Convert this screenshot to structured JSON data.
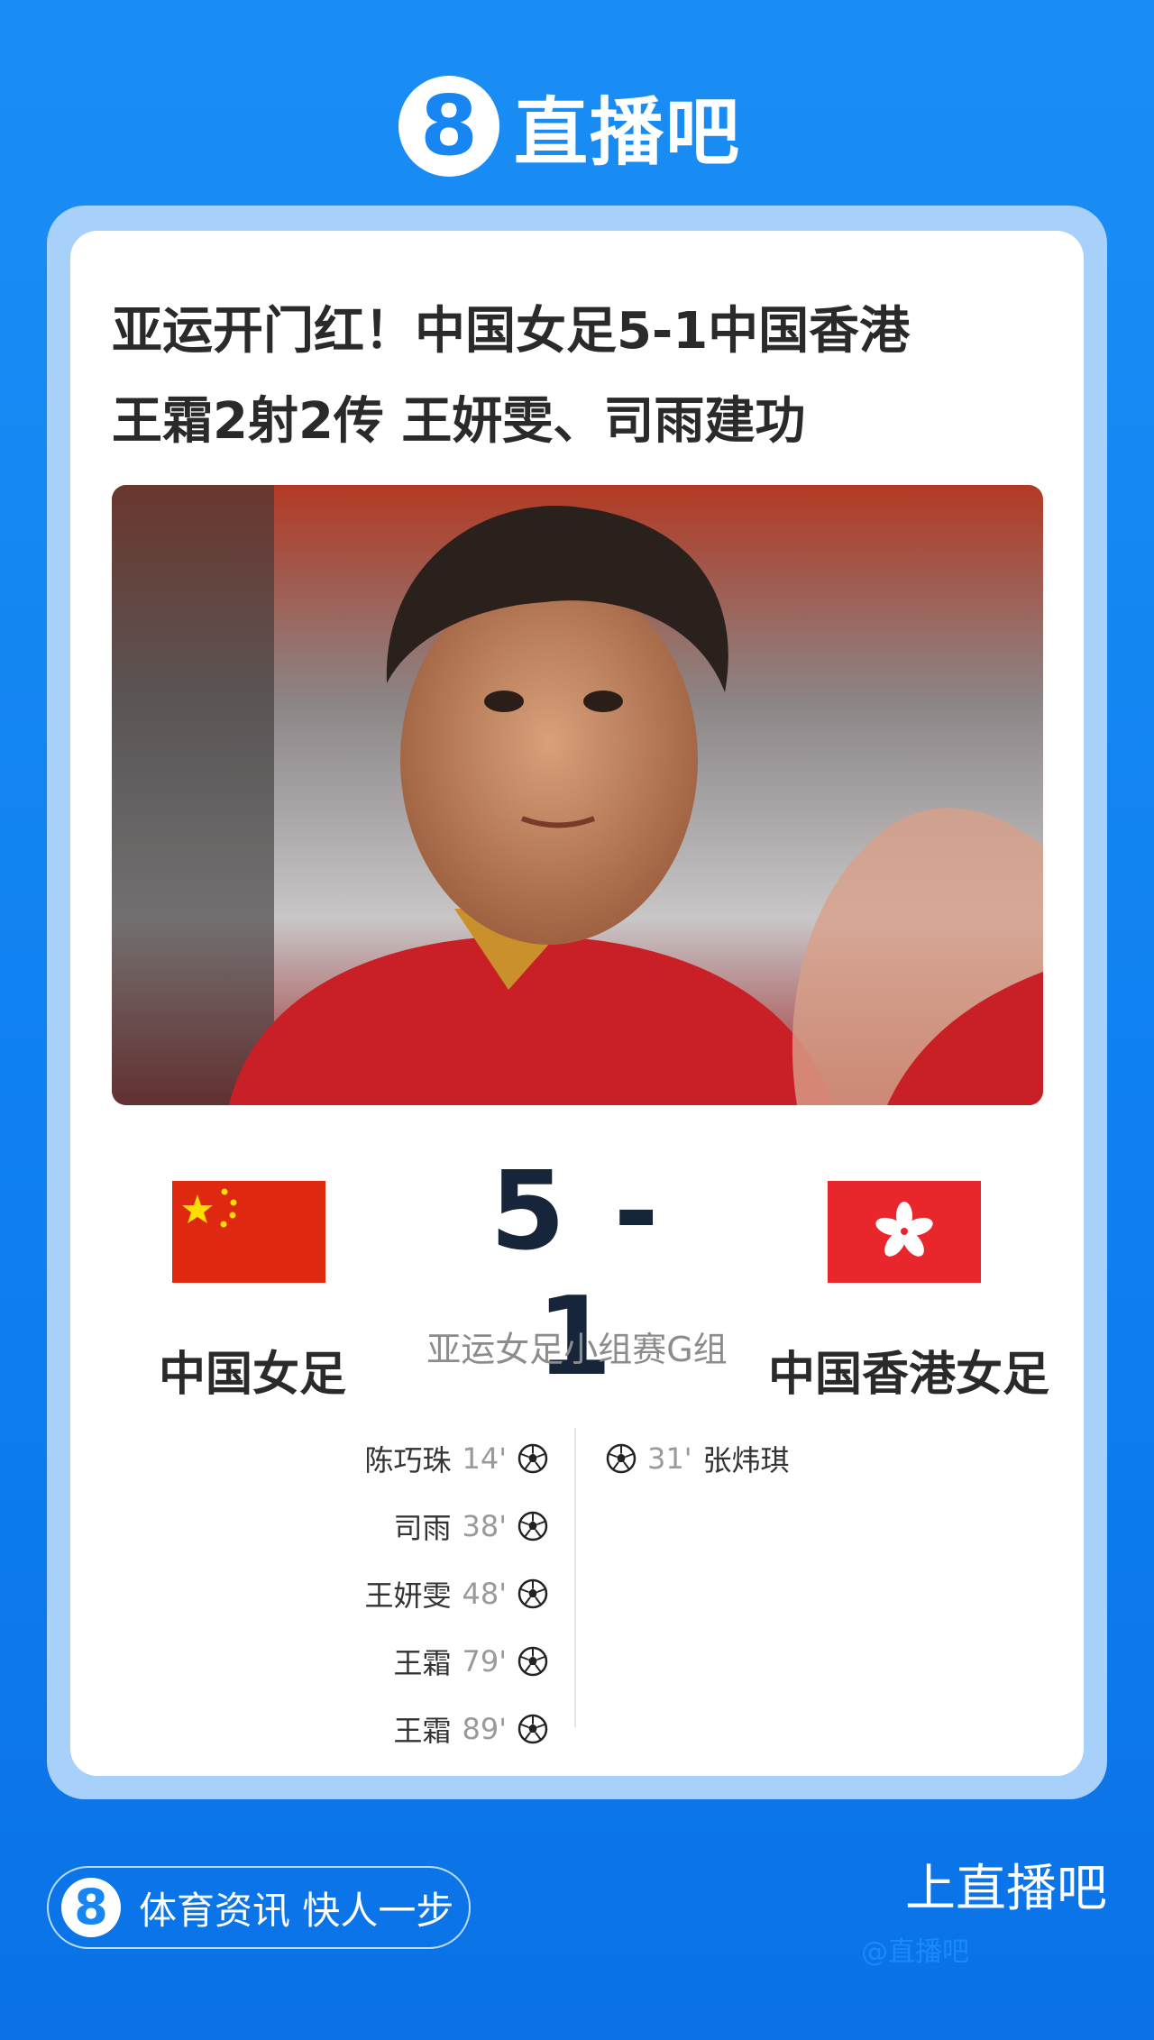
{
  "brand": {
    "logo_digit": "8",
    "name": "直播吧"
  },
  "headline": {
    "line1": "亚运开门红！中国女足5-1中国香港",
    "line2": "王霜2射2传 王妍雯、司雨建功"
  },
  "match": {
    "score": "5 - 1",
    "home_team": "中国女足",
    "away_team": "中国香港女足",
    "competition": "亚运女足小组赛G组",
    "home_goals": [
      {
        "player": "陈巧珠",
        "minute": "14'"
      },
      {
        "player": "司雨",
        "minute": "38'"
      },
      {
        "player": "王妍雯",
        "minute": "48'"
      },
      {
        "player": "王霜",
        "minute": "79'"
      },
      {
        "player": "王霜",
        "minute": "89'"
      }
    ],
    "away_goals": [
      {
        "player": "张炜琪",
        "minute": "31'"
      }
    ]
  },
  "footer": {
    "logo_digit": "8",
    "slogan": "体育资讯 快人一步",
    "cta": "上直播吧",
    "watermark": "@直播吧"
  },
  "colors": {
    "brand_blue": "#1785f2",
    "china_red": "#de2910",
    "hk_red": "#e9262b",
    "score_navy": "#16253a"
  }
}
